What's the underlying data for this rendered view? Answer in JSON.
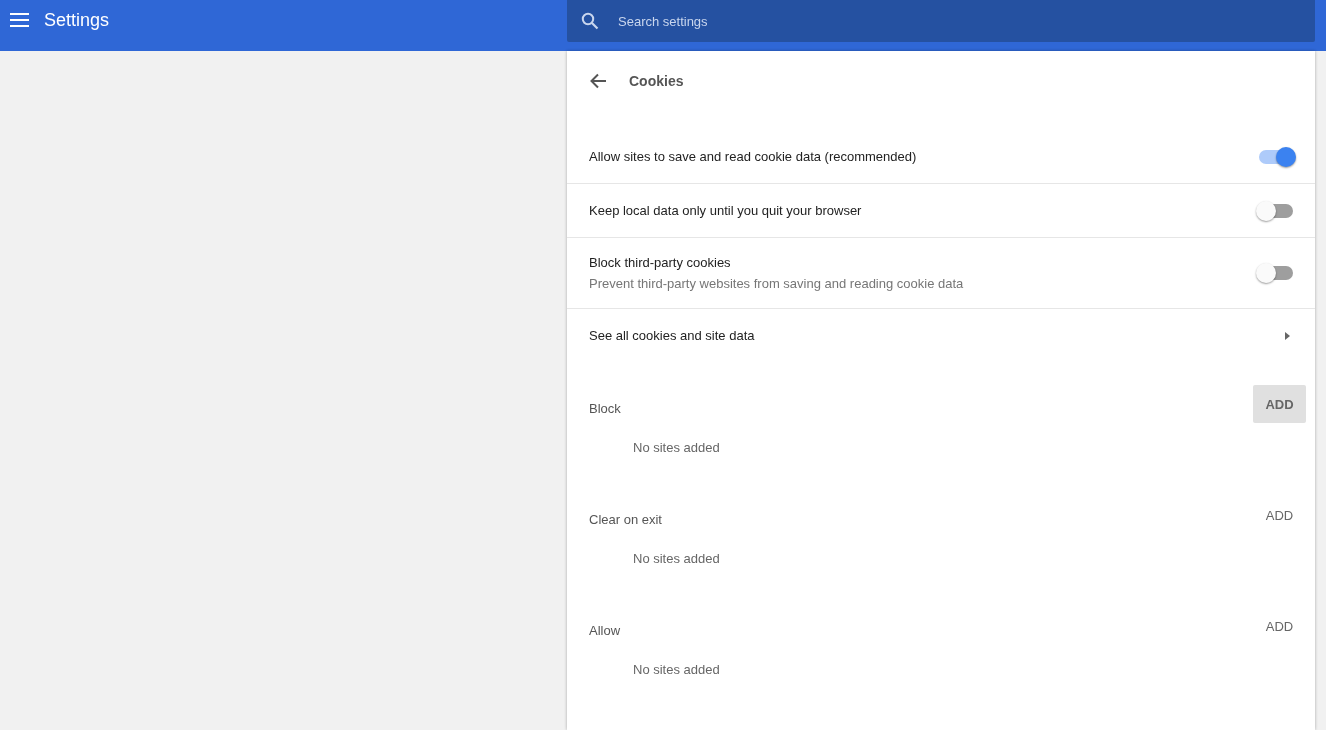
{
  "header": {
    "title": "Settings",
    "search": {
      "placeholder": "Search settings"
    }
  },
  "page": {
    "title": "Cookies"
  },
  "settings": [
    {
      "kind": "toggle",
      "label": "Allow sites to save and read cookie data (recommended)",
      "on": true
    },
    {
      "kind": "toggle",
      "label": "Keep local data only until you quit your browser",
      "on": false
    },
    {
      "kind": "toggle",
      "label": "Block third-party cookies",
      "description": "Prevent third-party websites from saving and reading cookie data",
      "on": false
    },
    {
      "kind": "link",
      "label": "See all cookies and site data"
    }
  ],
  "sections": [
    {
      "title": "Block",
      "button": {
        "label": "ADD",
        "focused": true
      },
      "empty": "No sites added"
    },
    {
      "title": "Clear on exit",
      "button": {
        "label": "ADD",
        "focused": false
      },
      "empty": "No sites added"
    },
    {
      "title": "Allow",
      "button": {
        "label": "ADD",
        "focused": false
      },
      "empty": "No sites added"
    }
  ]
}
